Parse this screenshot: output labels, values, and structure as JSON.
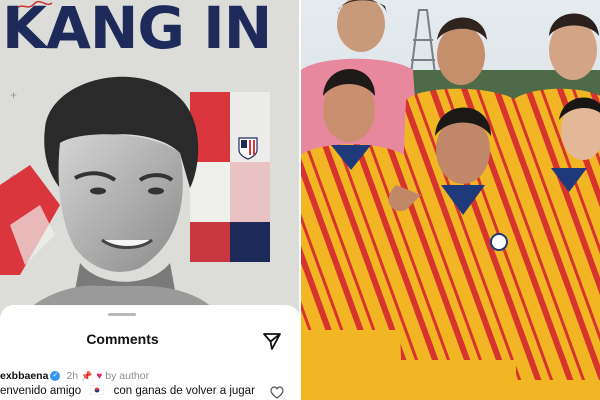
{
  "poster": {
    "title": "KANG IN",
    "colors": {
      "navy": "#1e2a5a",
      "red": "#d9363e",
      "background": "#dcdcd8"
    }
  },
  "comments": {
    "title": "Comments",
    "items": [
      {
        "username": "exbbaena",
        "age": "2h",
        "pinned": true,
        "liked_by_author": "by author",
        "text_before": "envenido amigo",
        "text_after": "con ganas de volver a jugar"
      }
    ]
  },
  "icons": {
    "send": "paper-plane-icon",
    "like": "heart-outline-icon",
    "pin": "pin-icon",
    "verified": "verified-badge-icon",
    "flag": "south-korea-flag-icon"
  },
  "team_photo": {
    "kit_colors": {
      "shirt": "#f2b624",
      "stripe": "#d6342c",
      "collar": "#1f3a7a"
    }
  }
}
